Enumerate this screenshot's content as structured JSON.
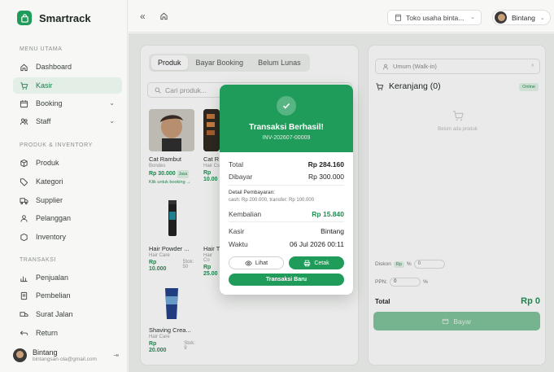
{
  "app": {
    "name": "Smartrack"
  },
  "sidebar": {
    "section_main": "MENU UTAMA",
    "section_product": "PRODUK & INVENTORY",
    "section_transaction": "TRANSAKSI",
    "items": [
      {
        "label": "Dashboard",
        "icon": "home-icon"
      },
      {
        "label": "Kasir",
        "icon": "cart-icon",
        "active": true
      },
      {
        "label": "Booking",
        "icon": "calendar-icon",
        "expandable": true
      },
      {
        "label": "Staff",
        "icon": "users-icon",
        "expandable": true
      },
      {
        "label": "Produk",
        "icon": "box-icon"
      },
      {
        "label": "Kategori",
        "icon": "tag-icon"
      },
      {
        "label": "Supplier",
        "icon": "truck-icon"
      },
      {
        "label": "Pelanggan",
        "icon": "customers-icon"
      },
      {
        "label": "Inventory",
        "icon": "inventory-icon"
      },
      {
        "label": "Penjualan",
        "icon": "chart-icon"
      },
      {
        "label": "Pembelian",
        "icon": "receipt-icon"
      },
      {
        "label": "Surat Jalan",
        "icon": "delivery-icon"
      },
      {
        "label": "Return",
        "icon": "return-icon"
      }
    ],
    "user": {
      "name": "Bintang",
      "email": "bintangsan·ola@gmail.com"
    }
  },
  "topbar": {
    "store": "Toko usaha binta...",
    "user": "Bintang"
  },
  "main": {
    "tabs": [
      "Produk",
      "Bayar Booking",
      "Belum Lunas"
    ],
    "search_placeholder": "Cari produk...",
    "products": [
      {
        "name": "Cat Rambut",
        "category": "Bondes",
        "price": "Rp 30.000",
        "badge": "Jasa",
        "link": "Klik untuk booking →"
      },
      {
        "name": "Cat R",
        "category": "Hair Cs",
        "price": "Rp 10.00"
      },
      {
        "name": "Hair Powder ...",
        "category": "Hair Care",
        "price": "Rp 10.000",
        "stock_label": "Stok:",
        "stock": "50"
      },
      {
        "name": "Hair T",
        "category": "Hair Co",
        "price": "Rp 25.00"
      },
      {
        "name": "Shaving Crea...",
        "category": "Hair Care",
        "price": "Rp 20.000",
        "stock_label": "Stok:",
        "stock": "9"
      }
    ]
  },
  "cart": {
    "customer": "Umum (Walk-in)",
    "title": "Keranjang (0)",
    "status": "Online",
    "empty": "Belum ada produk",
    "discount_label": "Diskon",
    "discount_unit": "Rp",
    "discount_pct": "%",
    "discount_value": "0",
    "ppn_label": "PPN:",
    "ppn_value": "0",
    "ppn_unit": "%",
    "total_label": "Total",
    "total_value": "Rp 0",
    "pay_label": "Bayar"
  },
  "modal": {
    "title": "Transaksi Berhasil!",
    "invoice": "INV-202607-00009",
    "total_label": "Total",
    "total_value": "Rp 284.160",
    "paid_label": "Dibayar",
    "paid_value": "Rp 300.000",
    "detail_title": "Detail Pembayaran:",
    "detail_text": "cash: Rp 200.000, transfer: Rp 100.000",
    "change_label": "Kembalian",
    "change_value": "Rp 15.840",
    "cashier_label": "Kasir",
    "cashier_value": "Bintang",
    "time_label": "Waktu",
    "time_value": "06 Jul 2026 00:11",
    "view_label": "Lihat",
    "print_label": "Cetak",
    "new_label": "Transaksi Baru"
  },
  "colors": {
    "accent": "#1f9b5a",
    "accent_light": "#7fc39c"
  }
}
